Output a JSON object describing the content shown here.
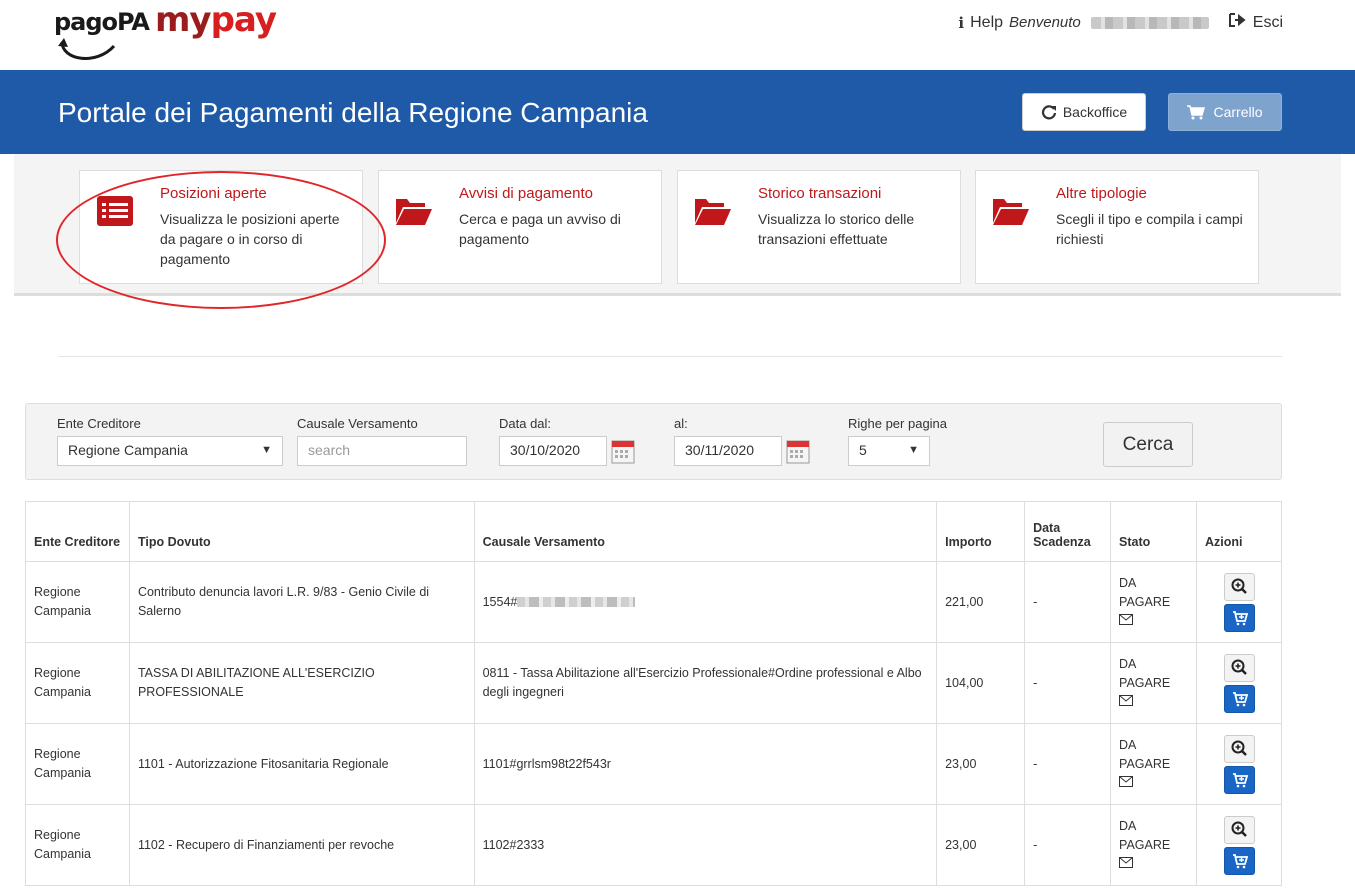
{
  "header": {
    "logo_pagopa": "pagoPA",
    "logo_my": "my",
    "logo_pay": "pay",
    "help_label": "Help",
    "welcome_label": "Benvenuto",
    "exit_label": "Esci"
  },
  "banner": {
    "title": "Portale dei Pagamenti della Regione Campania",
    "backoffice_label": "Backoffice",
    "cart_label": "Carrello"
  },
  "tiles": [
    {
      "title": "Posizioni aperte",
      "desc": "Visualizza le posizioni aperte da pagare o in corso di pagamento",
      "icon": "list-icon"
    },
    {
      "title": "Avvisi di pagamento",
      "desc": "Cerca e paga un avviso di pagamento",
      "icon": "folder-open-icon"
    },
    {
      "title": "Storico transazioni",
      "desc": "Visualizza lo storico delle transazioni effettuate",
      "icon": "folder-open-icon"
    },
    {
      "title": "Altre tipologie",
      "desc": "Scegli il tipo e compila i campi richiesti",
      "icon": "folder-open-icon"
    }
  ],
  "filter": {
    "ente_label": "Ente Creditore",
    "ente_value": "Regione Campania",
    "causale_label": "Causale Versamento",
    "causale_placeholder": "search",
    "data_dal_label": "Data dal:",
    "data_dal_value": "30/10/2020",
    "al_label": "al:",
    "al_value": "30/11/2020",
    "righe_label": "Righe per pagina",
    "righe_value": "5",
    "cerca_label": "Cerca"
  },
  "table": {
    "headers": {
      "ente": "Ente Creditore",
      "tipo": "Tipo Dovuto",
      "causale": "Causale Versamento",
      "importo": "Importo",
      "scadenza": "Data Scadenza",
      "stato": "Stato",
      "azioni": "Azioni"
    },
    "rows": [
      {
        "ente": "Regione Campania",
        "tipo": "Contributo denuncia lavori L.R. 9/83 - Genio Civile di Salerno",
        "causale": "1554#",
        "importo": "221,00",
        "scadenza": "-",
        "stato": "DA PAGARE"
      },
      {
        "ente": "Regione Campania",
        "tipo": "TASSA DI ABILITAZIONE ALL'ESERCIZIO PROFESSIONALE",
        "causale": "0811 - Tassa Abilitazione all'Esercizio Professionale#Ordine professional e Albo degli ingegneri",
        "importo": "104,00",
        "scadenza": "-",
        "stato": "DA PAGARE"
      },
      {
        "ente": "Regione Campania",
        "tipo": "1101 - Autorizzazione Fitosanitaria Regionale",
        "causale": "1101#grrlsm98t22f543r",
        "importo": "23,00",
        "scadenza": "-",
        "stato": "DA PAGARE"
      },
      {
        "ente": "Regione Campania",
        "tipo": "1102 - Recupero di Finanziamenti per revoche",
        "causale": "1102#2333",
        "importo": "23,00",
        "scadenza": "-",
        "stato": "DA PAGARE"
      }
    ]
  },
  "colors": {
    "banner": "#1e5aa8",
    "accent_red": "#c0171b",
    "buy_button": "#1a66c6"
  }
}
